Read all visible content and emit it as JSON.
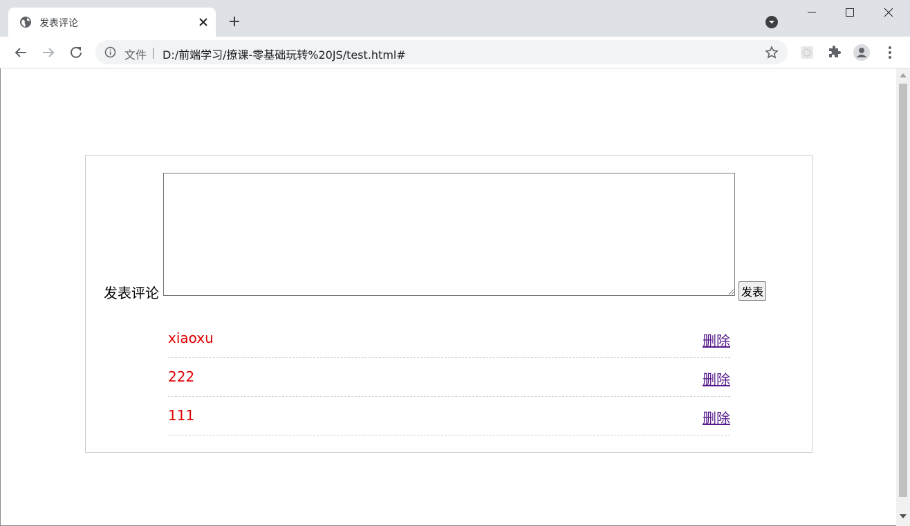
{
  "browser": {
    "tab_title": "发表评论",
    "scheme_label": "文件",
    "separator": "|",
    "url": "D:/前端学习/撩课-零基础玩转%20JS/test.html#"
  },
  "page": {
    "form_label": "发表评论",
    "textarea_value": "",
    "submit_label": "发表",
    "comments": [
      {
        "text": "xiaoxu",
        "delete_label": "删除"
      },
      {
        "text": "222",
        "delete_label": "删除"
      },
      {
        "text": "111",
        "delete_label": "删除"
      }
    ]
  },
  "colors": {
    "comment_text": "#e00000",
    "delete_link": "#551a8b",
    "tabstrip_bg": "#dee1e6"
  }
}
